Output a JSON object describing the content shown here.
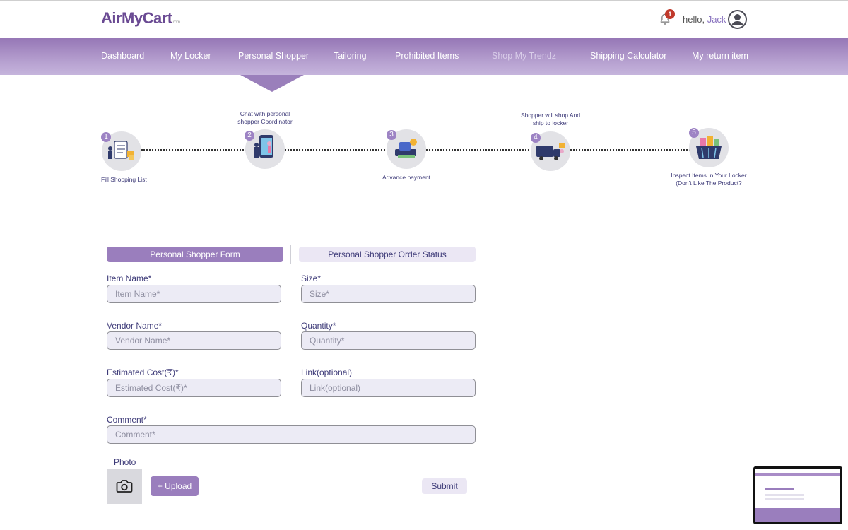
{
  "brand": {
    "logo": "AirMyCart",
    "logo_suffix": "com"
  },
  "header": {
    "notification_count": "1",
    "greeting": "hello,",
    "user_name": "Jack"
  },
  "nav": {
    "items": [
      {
        "label": "Dashboard"
      },
      {
        "label": "My Locker"
      },
      {
        "label": "Personal Shopper"
      },
      {
        "label": "Tailoring"
      },
      {
        "label": "Prohibited Items"
      },
      {
        "label": "Shop My Trendz"
      },
      {
        "label": "Shipping Calculator"
      },
      {
        "label": "My return item"
      }
    ],
    "active": "Personal Shopper"
  },
  "steps": [
    {
      "num": "1",
      "label": "Fill Shopping List"
    },
    {
      "num": "2",
      "label_line1": "Chat with personal",
      "label_line2": "shopper Coordinator"
    },
    {
      "num": "3",
      "label": "Advance payment"
    },
    {
      "num": "4",
      "label_line1": "Shopper will shop And",
      "label_line2": "ship to locker"
    },
    {
      "num": "5",
      "label_line1": "Inspect Items In Your Locker",
      "label_line2": "(Don't Like The Product?"
    }
  ],
  "tabs": {
    "form": "Personal Shopper Form",
    "status": "Personal Shopper Order Status"
  },
  "form": {
    "item_name": {
      "label": "Item Name*",
      "placeholder": "Item Name*"
    },
    "size": {
      "label": "Size*",
      "placeholder": "Size*"
    },
    "vendor_name": {
      "label": "Vendor Name*",
      "placeholder": "Vendor Name*"
    },
    "quantity": {
      "label": "Quantity*",
      "placeholder": "Quantity*"
    },
    "estimated_cost": {
      "label": "Estimated Cost(₹)*",
      "placeholder": "Estimated Cost(₹)*"
    },
    "link": {
      "label": "Link(optional)",
      "placeholder": "Link(optional)"
    },
    "comment": {
      "label": "Comment*",
      "placeholder": "Comment*"
    },
    "photo_label": "Photo",
    "upload_label": "+ Upload",
    "submit_label": "Submit"
  },
  "colors": {
    "accent": "#9a7ebd",
    "label_text": "#3d3a78",
    "input_bg": "#ecebf5"
  },
  "icons": {
    "bell": "bell-icon",
    "avatar": "user-avatar-icon",
    "camera": "camera-icon"
  }
}
